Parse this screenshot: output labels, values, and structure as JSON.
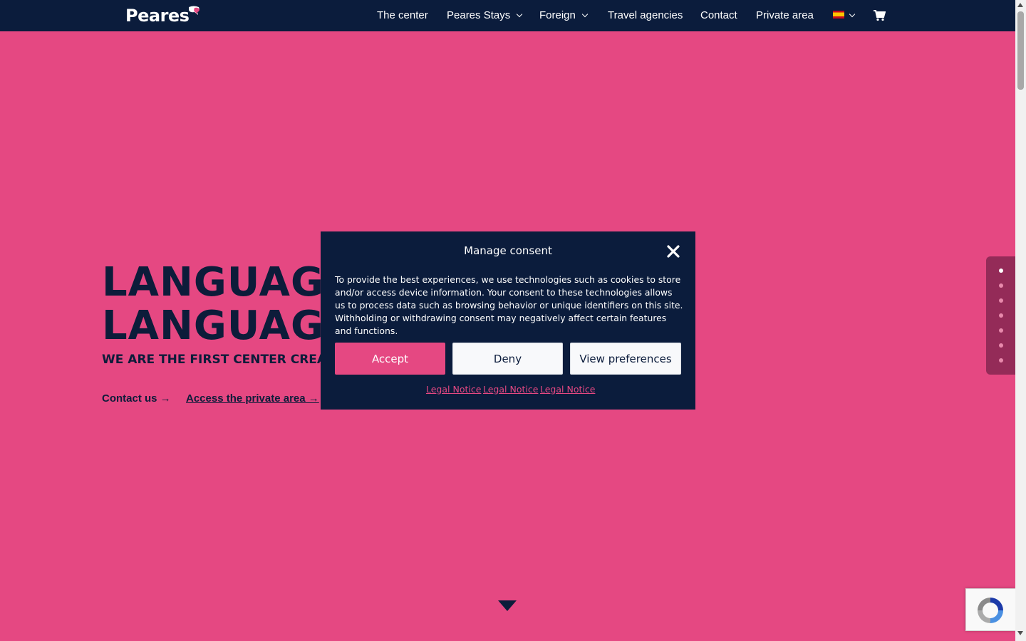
{
  "header": {
    "logo_text": "Peares",
    "nav": [
      {
        "label": "The center",
        "has_dropdown": false
      },
      {
        "label": "Peares Stays",
        "has_dropdown": true
      },
      {
        "label": "Foreign",
        "has_dropdown": true
      },
      {
        "label": "Travel agencies",
        "has_dropdown": false
      },
      {
        "label": "Contact",
        "has_dropdown": false
      },
      {
        "label": "Private area",
        "has_dropdown": false
      }
    ],
    "language_icon": "spain-flag-icon",
    "cart_icon": "cart-icon"
  },
  "hero": {
    "title_line1": "LANGUAGE",
    "title_line2": "LANGUAGE",
    "subtitle": "WE ARE THE FIRST CENTER CREATE",
    "contact_link": "Contact us →",
    "private_link": "Access the private area →"
  },
  "dots_nav": {
    "count": 7,
    "active_index": 0
  },
  "consent": {
    "title": "Manage consent",
    "text": "To provide the best experiences, we use technologies such as cookies to store and/or access device information. Your consent to these technologies allows us to process data such as browsing behavior or unique identifiers on this site. Withholding or withdrawing consent may negatively affect certain features and functions.",
    "accept_label": "Accept",
    "deny_label": "Deny",
    "preferences_label": "View preferences",
    "legal_links": [
      "Legal Notice",
      "Legal Notice",
      "Legal Notice"
    ]
  },
  "colors": {
    "background": "#e54882",
    "navy": "#0b1c3c",
    "accent": "#e54882"
  }
}
